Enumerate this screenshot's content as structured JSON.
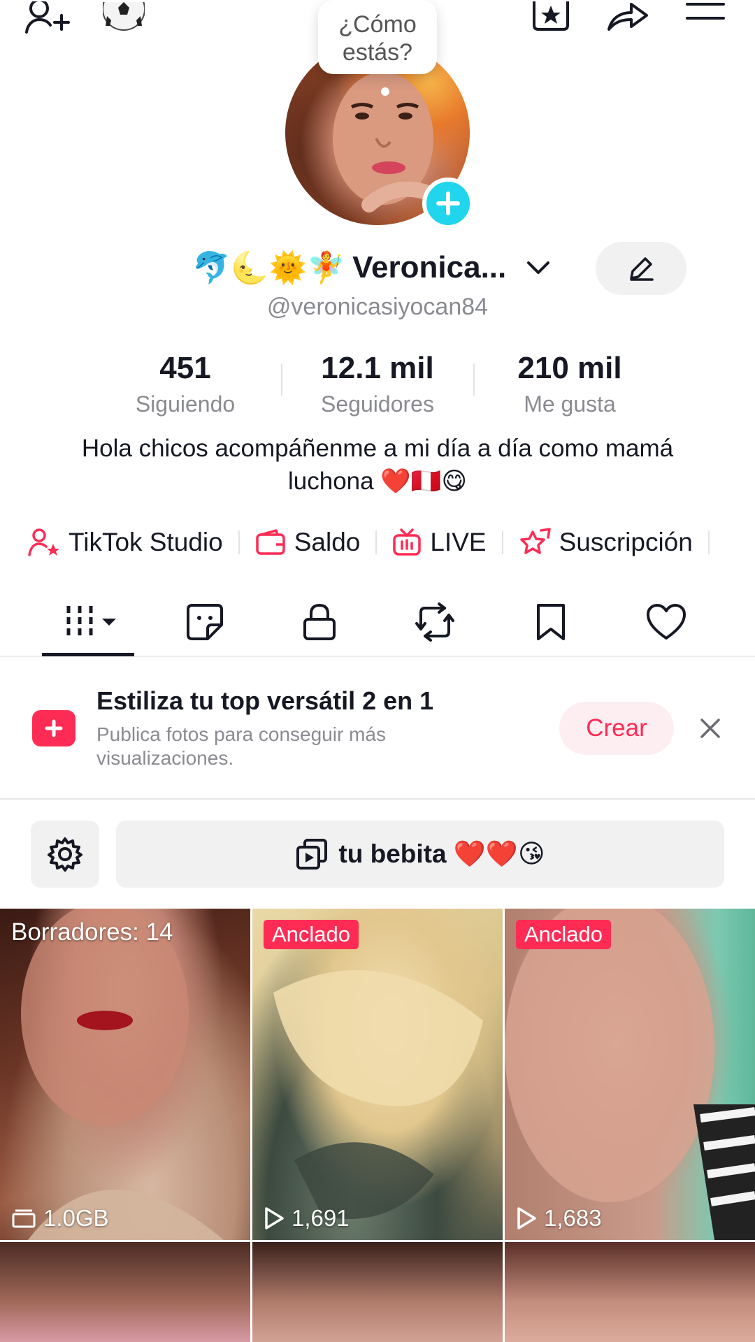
{
  "header": {
    "mood_bubble": "¿Cómo estás?"
  },
  "profile": {
    "emojis": "🐬🌜🌞🧚",
    "display_name": "Veronica...",
    "username": "@veronicasiyocan84",
    "bio": "Hola chicos acompáñenme a mi día a día como mamá luchona ❤️🇵🇪😋"
  },
  "stats": [
    {
      "value": "451",
      "label": "Siguiendo"
    },
    {
      "value": "12.1 mil",
      "label": "Seguidores"
    },
    {
      "value": "210 mil",
      "label": "Me gusta"
    }
  ],
  "tools": [
    {
      "label": "TikTok Studio",
      "icon": "person-star-icon"
    },
    {
      "label": "Saldo",
      "icon": "wallet-icon"
    },
    {
      "label": "LIVE",
      "icon": "tv-icon"
    },
    {
      "label": "Suscripción",
      "icon": "star-badge-icon"
    }
  ],
  "promo": {
    "title": "Estiliza tu top versátil 2 en 1",
    "subtitle": "Publica fotos para conseguir más visualizaciones.",
    "button": "Crear"
  },
  "playlist": {
    "label": "tu bebita ❤️❤️😘"
  },
  "grid": [
    {
      "label": "Borradores: 14",
      "bottom": "1.0GB"
    },
    {
      "badge": "Anclado",
      "bottom": "1,691"
    },
    {
      "badge": "Anclado",
      "bottom": "1,683"
    }
  ],
  "colors": {
    "accent": "#fe2c55",
    "avatar_plus": "#20d5ec",
    "text": "#161823",
    "muted": "#8a8b91"
  }
}
